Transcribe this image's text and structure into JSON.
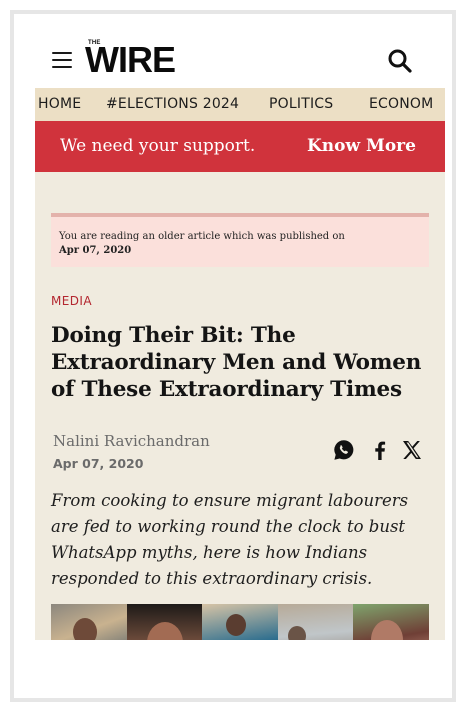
{
  "header": {
    "logo_small": "THE",
    "logo_main": "WIRE",
    "menu_icon": "hamburger-menu-icon",
    "search_icon": "search-icon"
  },
  "nav": {
    "items": [
      "HOME",
      "#ELECTIONS 2024",
      "POLITICS",
      "ECONOM"
    ]
  },
  "banner": {
    "text": "We need your support.",
    "cta": "Know More",
    "color": "#d0333c"
  },
  "notice": {
    "text": "You are reading an older article which was published on",
    "date": "Apr 07, 2020"
  },
  "article": {
    "category": "MEDIA",
    "title": "Doing Their Bit: The Extraordinary Men and Women of These Extraordinary Times",
    "author": "Nalini Ravichandran",
    "date": "Apr 07, 2020",
    "excerpt": "From cooking to ensure migrant labourers are fed to working round the clock to bust WhatsApp myths, here is how Indians responded to this extraordinary crisis.",
    "share_icons": [
      "whatsapp-icon",
      "facebook-icon",
      "x-icon"
    ]
  },
  "colors": {
    "nav_bg": "#ecdfc5",
    "article_bg": "#f0ebdf",
    "category": "#b3262f",
    "notice_bg": "#fbe0db"
  }
}
